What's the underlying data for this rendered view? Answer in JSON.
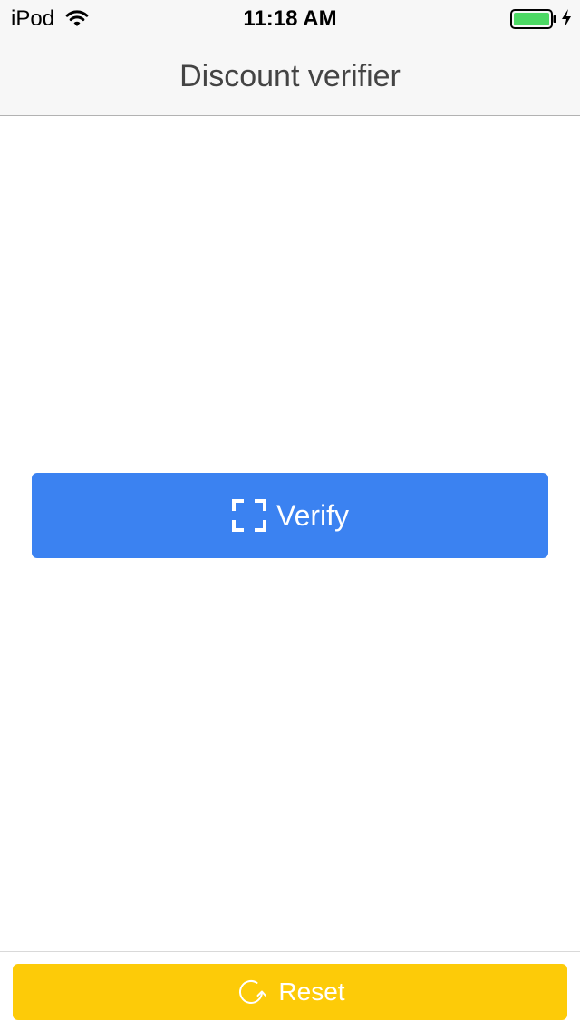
{
  "status_bar": {
    "carrier": "iPod",
    "wifi_icon": "wifi-icon",
    "time": "11:18 AM",
    "battery_icon": "battery-icon",
    "battery_level": 1.0,
    "battery_color": "#4cd964",
    "charging_icon": "charging-bolt-icon"
  },
  "nav": {
    "title": "Discount verifier"
  },
  "main": {
    "verify_button": {
      "icon": "scan-frame-icon",
      "label": "Verify",
      "color": "#3b82f1"
    }
  },
  "footer": {
    "reset_button": {
      "icon": "refresh-icon",
      "label": "Reset",
      "color": "#fdcb08"
    }
  }
}
